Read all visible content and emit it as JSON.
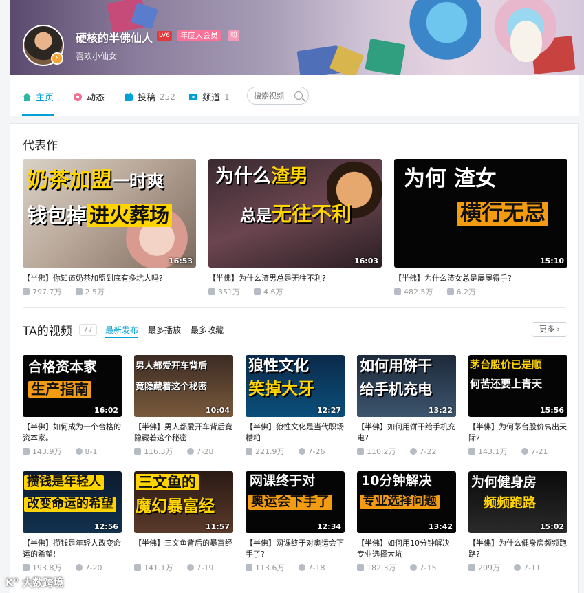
{
  "profile": {
    "name": "硬核的半佛仙人",
    "level": "LV6",
    "vip": "年度大会员",
    "badge": "粉",
    "sign": "喜欢小仙女"
  },
  "nav": {
    "home": "主页",
    "dynamic": "动态",
    "videos": "投稿",
    "videos_count": "252",
    "channel": "频道",
    "channel_count": "1",
    "search_placeholder": "搜索视频"
  },
  "masterpiece": {
    "title": "代表作",
    "items": [
      {
        "thumb_line1": "奶茶加盟",
        "thumb_line1b": "一时爽",
        "thumb_line2": "钱包掉",
        "thumb_line2b": "进火葬场",
        "duration": "16:53",
        "title": "【半佛】你知道奶茶加盟到底有多坑人吗?",
        "views": "797.7万",
        "danmaku": "2.5万"
      },
      {
        "thumb_line1": "为什么",
        "thumb_line1b": "渣男",
        "thumb_line2": "总是",
        "thumb_line2b": "无往不利",
        "duration": "16:03",
        "title": "【半佛】为什么渣男总是无往不利?",
        "views": "351万",
        "danmaku": "4.6万"
      },
      {
        "thumb_line1": "为何 渣女",
        "thumb_line2": "横行无忌",
        "duration": "15:10",
        "title": "【半佛】为什么渣女总是屡屡得手?",
        "views": "482.5万",
        "danmaku": "6.2万"
      }
    ]
  },
  "videos": {
    "title": "TA的视频",
    "count": "77",
    "tabs": [
      "最新发布",
      "最多播放",
      "最多收藏"
    ],
    "more": "更多",
    "items": [
      {
        "t1": "合格资本家",
        "t2": "生产指南",
        "duration": "16:02",
        "title": "【半佛】如何成为一个合格的资本家。",
        "views": "143.9万",
        "date": "8-1"
      },
      {
        "t1": "男人都爱开车背后",
        "t2": "竟隐藏着这个秘密",
        "duration": "10:04",
        "title": "【半佛】男人都爱开车背后竟隐藏着这个秘密",
        "views": "116.3万",
        "date": "7-28"
      },
      {
        "t1": "狼性文化",
        "t2": "笑掉大牙",
        "duration": "12:27",
        "title": "【半佛】狼性文化是当代职场糟粕",
        "views": "221.9万",
        "date": "7-26"
      },
      {
        "t1": "如何用饼干",
        "t2": "给手机充电",
        "duration": "13:22",
        "title": "【半佛】如何用饼干给手机充电?",
        "views": "110.2万",
        "date": "7-22"
      },
      {
        "t1": "茅台股价已是顺",
        "t2": "何苦还要上青天",
        "duration": "15:56",
        "title": "【半佛】为何茅台股价高出天际?",
        "views": "143.1万",
        "date": "7-21"
      },
      {
        "t1": "攒钱是年轻人",
        "t2": "改变命运的希望",
        "duration": "12:56",
        "title": "【半佛】攒钱是年轻人改变命运的希望!",
        "views": "193.8万",
        "date": "7-20"
      },
      {
        "t1": "三文鱼的",
        "t2": "魔幻暴富经",
        "duration": "11:57",
        "title": "【半佛】三文鱼背后的暴富经",
        "views": "141.1万",
        "date": "7-19"
      },
      {
        "t1": "网课终于对",
        "t2": "奥运会下手了",
        "duration": "12:34",
        "title": "【半佛】网课终于对奥运会下手了?",
        "views": "113.6万",
        "date": "7-18"
      },
      {
        "t1": "10分钟解决",
        "t2": "专业选择问题",
        "duration": "13:42",
        "title": "【半佛】如何用10分钟解决专业选择大坑",
        "views": "182.3万",
        "date": "7-15"
      },
      {
        "t1": "为何健身房",
        "t2": "频频跑路",
        "duration": "15:02",
        "title": "【半佛】为什么健身房频频跑路?",
        "views": "209万",
        "date": "7-11"
      }
    ]
  },
  "watermark": "大数跨境",
  "colors": {
    "accent": "#00a1d6",
    "vip_pink": "#fb7299",
    "thumb_yellow": "#ffd400",
    "thumb_orange": "#f39c12"
  }
}
